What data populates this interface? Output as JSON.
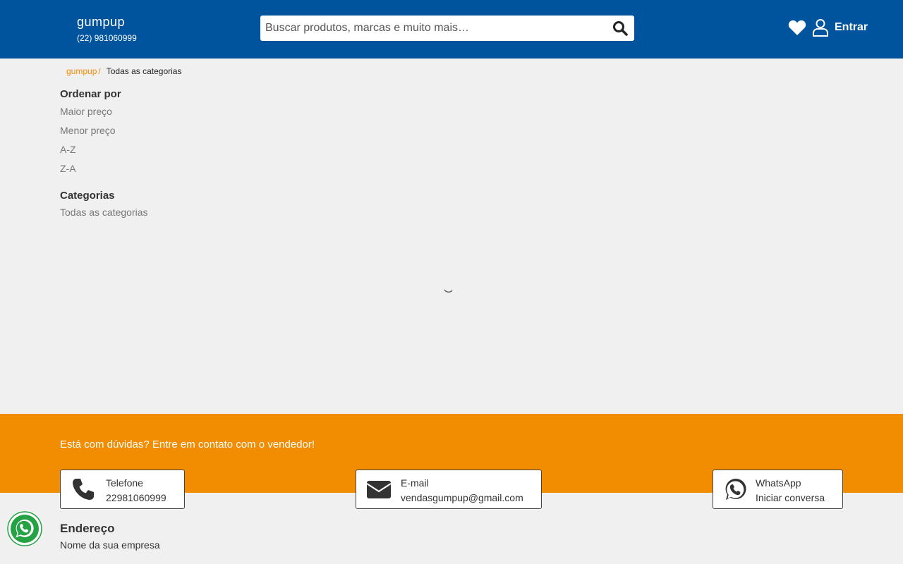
{
  "header": {
    "brand_name": "gumpup",
    "brand_phone": "(22) 981060999",
    "search_placeholder": "Buscar produtos, marcas e muito mais…",
    "login_label": "Entrar"
  },
  "breadcrumb": {
    "home": "gumpup",
    "separator": "/",
    "current": "Todas as categorias"
  },
  "sidebar": {
    "sort_title": "Ordenar por",
    "sort_options": [
      "Maior preço",
      "Menor preço",
      "A-Z",
      "Z-A"
    ],
    "categories_title": "Categorias",
    "categories": [
      "Todas as categorias"
    ]
  },
  "footer": {
    "contact_title": "Está com dúvidas? Entre em contato com o vendedor!",
    "contacts": [
      {
        "label": "Telefone",
        "value": "22981060999",
        "icon": "phone-icon"
      },
      {
        "label": "E-mail",
        "value": "vendasgumpup@gmail.com",
        "icon": "envelope-icon"
      },
      {
        "label": "WhatsApp",
        "value": "Iniciar conversa",
        "icon": "whatsapp-icon"
      }
    ],
    "address_title": "Endereço",
    "address_value": "Nome da sua empresa"
  },
  "colors": {
    "header_bg": "#00549e",
    "accent_orange": "#f28c00",
    "whatsapp_green": "#25a244"
  }
}
